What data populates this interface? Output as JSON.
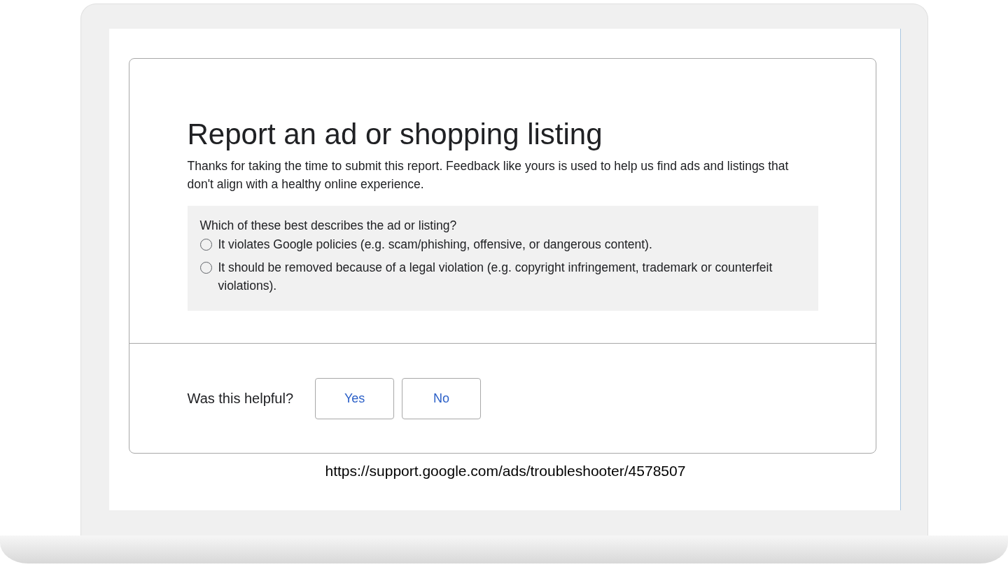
{
  "card": {
    "title": "Report an ad or shopping listing",
    "intro": "Thanks for taking the time to submit this report. Feedback like yours is used to help us find ads and listings that don't align with a healthy online experience.",
    "question": "Which of these best describes the ad or listing?",
    "options": [
      {
        "label": "It violates Google policies (e.g. scam/phishing, offensive, or dangerous content).",
        "selected": false
      },
      {
        "label": "It should be removed because of a legal violation (e.g. copyright infringement, trademark or counterfeit violations).",
        "selected": false
      }
    ],
    "feedback": {
      "prompt": "Was this helpful?",
      "buttons": [
        "Yes",
        "No"
      ]
    }
  },
  "caption": "https://support.google.com/ads/troubleshooter/4578507"
}
